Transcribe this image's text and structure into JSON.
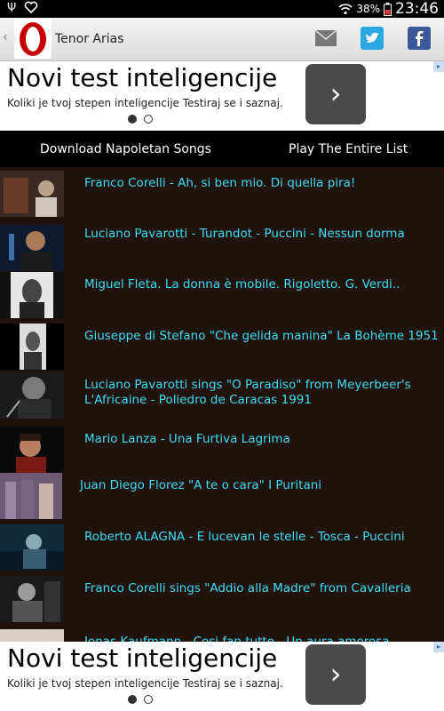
{
  "status_bar": {
    "usb_icon": "usb-icon",
    "heart_icon": "heart-icon",
    "battery_percent": "38%",
    "time": "23:46"
  },
  "app_bar": {
    "title": "Tenor Arias",
    "back_icon": "back-chevron-icon",
    "logo": "app-logo",
    "mail_icon": "mail-icon",
    "twitter_icon": "twitter-icon",
    "facebook_icon": "facebook-icon"
  },
  "ad_top": {
    "headline": "Novi test inteligencije",
    "subtext": "Koliki je tvoj stepen inteligencije Testiraj se i saznaj.",
    "arrow": "›"
  },
  "ad_bottom": {
    "headline": "Novi test inteligencije",
    "subtext": "Koliki je tvoj stepen inteligencije Testiraj se i saznaj.",
    "arrow": "›"
  },
  "actions": {
    "download": "Download Napoletan Songs",
    "play_all": "Play The Entire List"
  },
  "songs": [
    {
      "title": "Franco Corelli - Ah, si ben mio. Di quella pira!"
    },
    {
      "title": "Luciano Pavarotti - Turandot - Puccini - Nessun dorma"
    },
    {
      "title": "Miguel Fleta. La donna è mobile. Rigoletto. G. Verdi.."
    },
    {
      "title": "Giuseppe di Stefano \"Che gelida manina\" La Bohème 1951"
    },
    {
      "title": "Luciano Pavarotti sings \"O Paradiso\" from Meyerbeer's L'Africaine - Poliedro de Caracas 1991"
    },
    {
      "title": "Mario Lanza - Una Furtiva Lagrima"
    },
    {
      "title": "Juan Diego Florez \"A te o cara\" I Puritani"
    },
    {
      "title": "Roberto ALAGNA - E lucevan le stelle - Tosca - Puccini"
    },
    {
      "title": "Franco Corelli sings \"Addio alla Madre\" from Cavalleria"
    },
    {
      "title": "Jonas Kaufmann - Cosi fan tutte - Un aura amorosa"
    }
  ]
}
